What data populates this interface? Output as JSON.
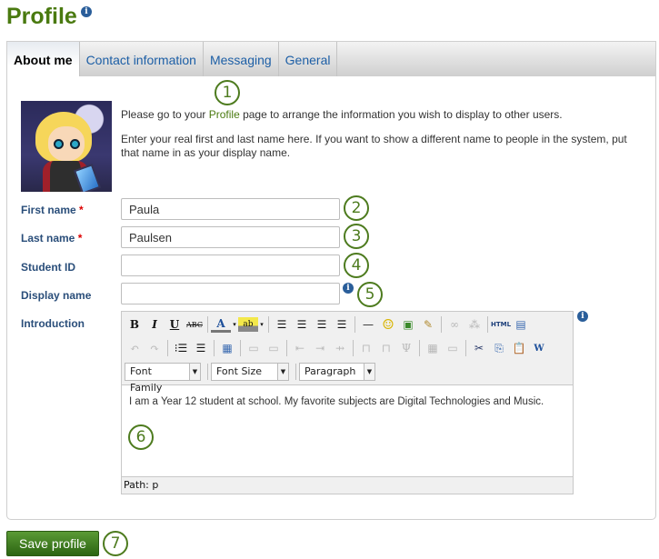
{
  "page": {
    "title": "Profile",
    "title_info_icon": "info-icon"
  },
  "tabs": [
    {
      "label": "About me",
      "active": true
    },
    {
      "label": "Contact information",
      "active": false
    },
    {
      "label": "Messaging",
      "active": false
    },
    {
      "label": "General",
      "active": false
    }
  ],
  "intro": {
    "line1_before": "Please go to your ",
    "line1_link": "Profile",
    "line1_after": " page to arrange the information you wish to display to other users.",
    "line2a": "Enter your real first and last name here. If you want to show a different name to people in the system, put",
    "line2b": "that name in as your display name."
  },
  "form": {
    "first_name": {
      "label": "First name",
      "required_mark": "*",
      "value": "Paula"
    },
    "last_name": {
      "label": "Last name",
      "required_mark": "*",
      "value": "Paulsen"
    },
    "student_id": {
      "label": "Student ID",
      "value": ""
    },
    "display_name": {
      "label": "Display name",
      "value": ""
    },
    "introduction": {
      "label": "Introduction"
    }
  },
  "editor": {
    "row1": [
      "bold-icon",
      "italic-icon",
      "underline-icon",
      "strikethrough-icon",
      "font-color-icon",
      "highlight-color-icon",
      "align-left-icon",
      "align-center-icon",
      "align-right-icon",
      "align-justify-icon",
      "horizontal-rule-icon",
      "emoticon-icon",
      "image-icon",
      "cleanup-icon",
      "link-icon",
      "unlink-icon",
      "html-source-icon",
      "fullscreen-icon"
    ],
    "row2": [
      "undo-icon",
      "redo-icon",
      "bullet-list-icon",
      "numbered-list-icon",
      "table-icon",
      "row-props-icon",
      "cell-props-icon",
      "insert-row-before-icon",
      "insert-row-after-icon",
      "delete-row-icon",
      "insert-col-before-icon",
      "insert-col-after-icon",
      "delete-col-icon",
      "split-cells-icon",
      "merge-cells-icon",
      "cut-icon",
      "copy-icon",
      "paste-icon",
      "paste-word-icon"
    ],
    "font_family": "Font Family",
    "font_size": "Font Size",
    "format": "Paragraph",
    "html_label": "HTML",
    "content": "I am a Year 12 student at school. My favorite subjects are Digital Technologies and Music.",
    "path": "Path: p"
  },
  "callouts": [
    "1",
    "2",
    "3",
    "4",
    "5",
    "6",
    "7"
  ],
  "actions": {
    "save_label": "Save profile"
  },
  "colors": {
    "title": "#4a7a10",
    "link": "#1d5fa6",
    "label": "#2a4e7a",
    "button": "#3d7d1e",
    "callout": "#4d7b1e"
  }
}
